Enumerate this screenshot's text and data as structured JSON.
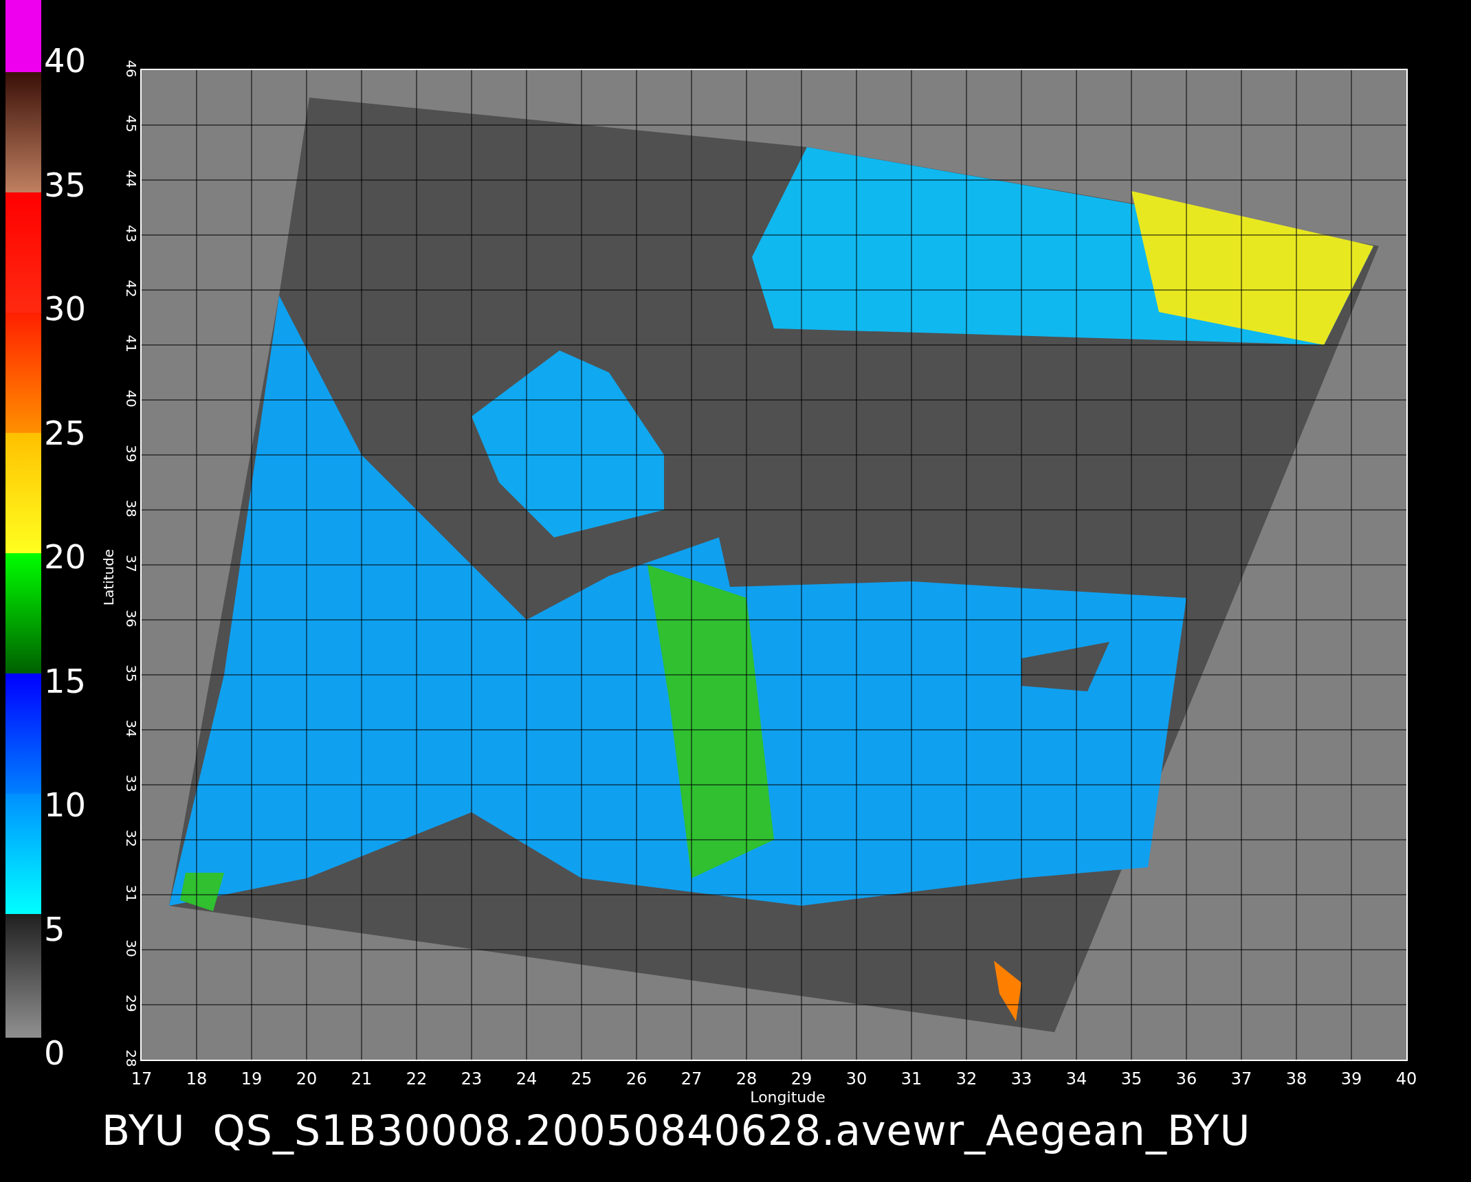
{
  "colorbar": {
    "labels": [
      "40",
      "35",
      "30",
      "25",
      "20",
      "15",
      "10",
      "5",
      "0"
    ]
  },
  "plot": {
    "ylabel": "Latitude",
    "xlabel": "Longitude",
    "yticks": [
      "46",
      "45",
      "44",
      "43",
      "42",
      "41",
      "40",
      "39",
      "38",
      "37",
      "36",
      "35",
      "34",
      "33",
      "32",
      "31",
      "30",
      "29",
      "28"
    ],
    "xticks": [
      "17",
      "18",
      "19",
      "20",
      "21",
      "22",
      "23",
      "24",
      "25",
      "26",
      "27",
      "28",
      "29",
      "30",
      "31",
      "32",
      "33",
      "34",
      "35",
      "36",
      "37",
      "38",
      "39",
      "40"
    ]
  },
  "title": "BYU  QS_S1B30008.20050840628.avewr_Aegean_BYU"
}
